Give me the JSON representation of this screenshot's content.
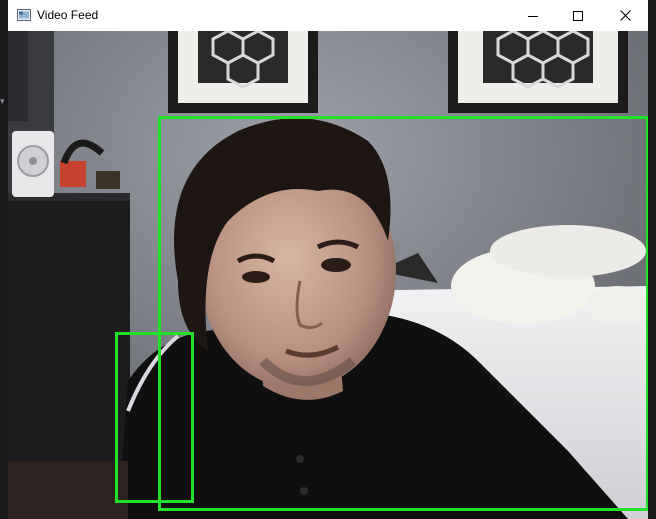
{
  "window": {
    "title": "Video Feed",
    "icon": "app-window-icon",
    "controls": [
      "minimize-icon",
      "maximize-icon",
      "close-icon"
    ]
  },
  "video": {
    "detections": [
      {
        "id": "face-detection",
        "color": "#22e12a"
      },
      {
        "id": "shoulder-detection",
        "color": "#22e12a"
      }
    ]
  }
}
